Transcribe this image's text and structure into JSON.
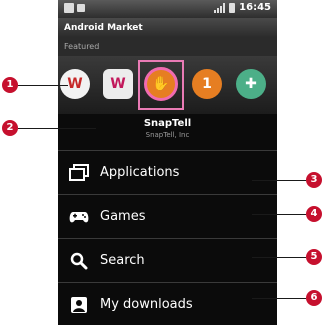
{
  "status_bar": {
    "time": "16:45",
    "icons": [
      "notification-icon",
      "sd-card-icon",
      "signal-icon",
      "battery-icon"
    ]
  },
  "app_title": "Android Market",
  "featured_label": "Featured",
  "featured_apps": [
    {
      "icon": "w-app-icon",
      "glyph": "W"
    },
    {
      "icon": "w-purple-app-icon",
      "glyph": "W"
    },
    {
      "icon": "snaptell-icon",
      "glyph": "✋"
    },
    {
      "icon": "one-app-icon",
      "glyph": "1"
    },
    {
      "icon": "game-pad-app-icon",
      "glyph": "✚"
    }
  ],
  "selected_app": {
    "name": "SnapTell",
    "vendor": "SnapTell, Inc"
  },
  "menu": [
    {
      "label": "Applications",
      "icon": "applications-icon"
    },
    {
      "label": "Games",
      "icon": "games-icon"
    },
    {
      "label": "Search",
      "icon": "search-icon"
    },
    {
      "label": "My downloads",
      "icon": "downloads-icon"
    }
  ],
  "callouts": [
    "1",
    "2",
    "3",
    "4",
    "5",
    "6"
  ],
  "colors": {
    "callout": "#c6102e",
    "selection": "#e97bb5"
  }
}
